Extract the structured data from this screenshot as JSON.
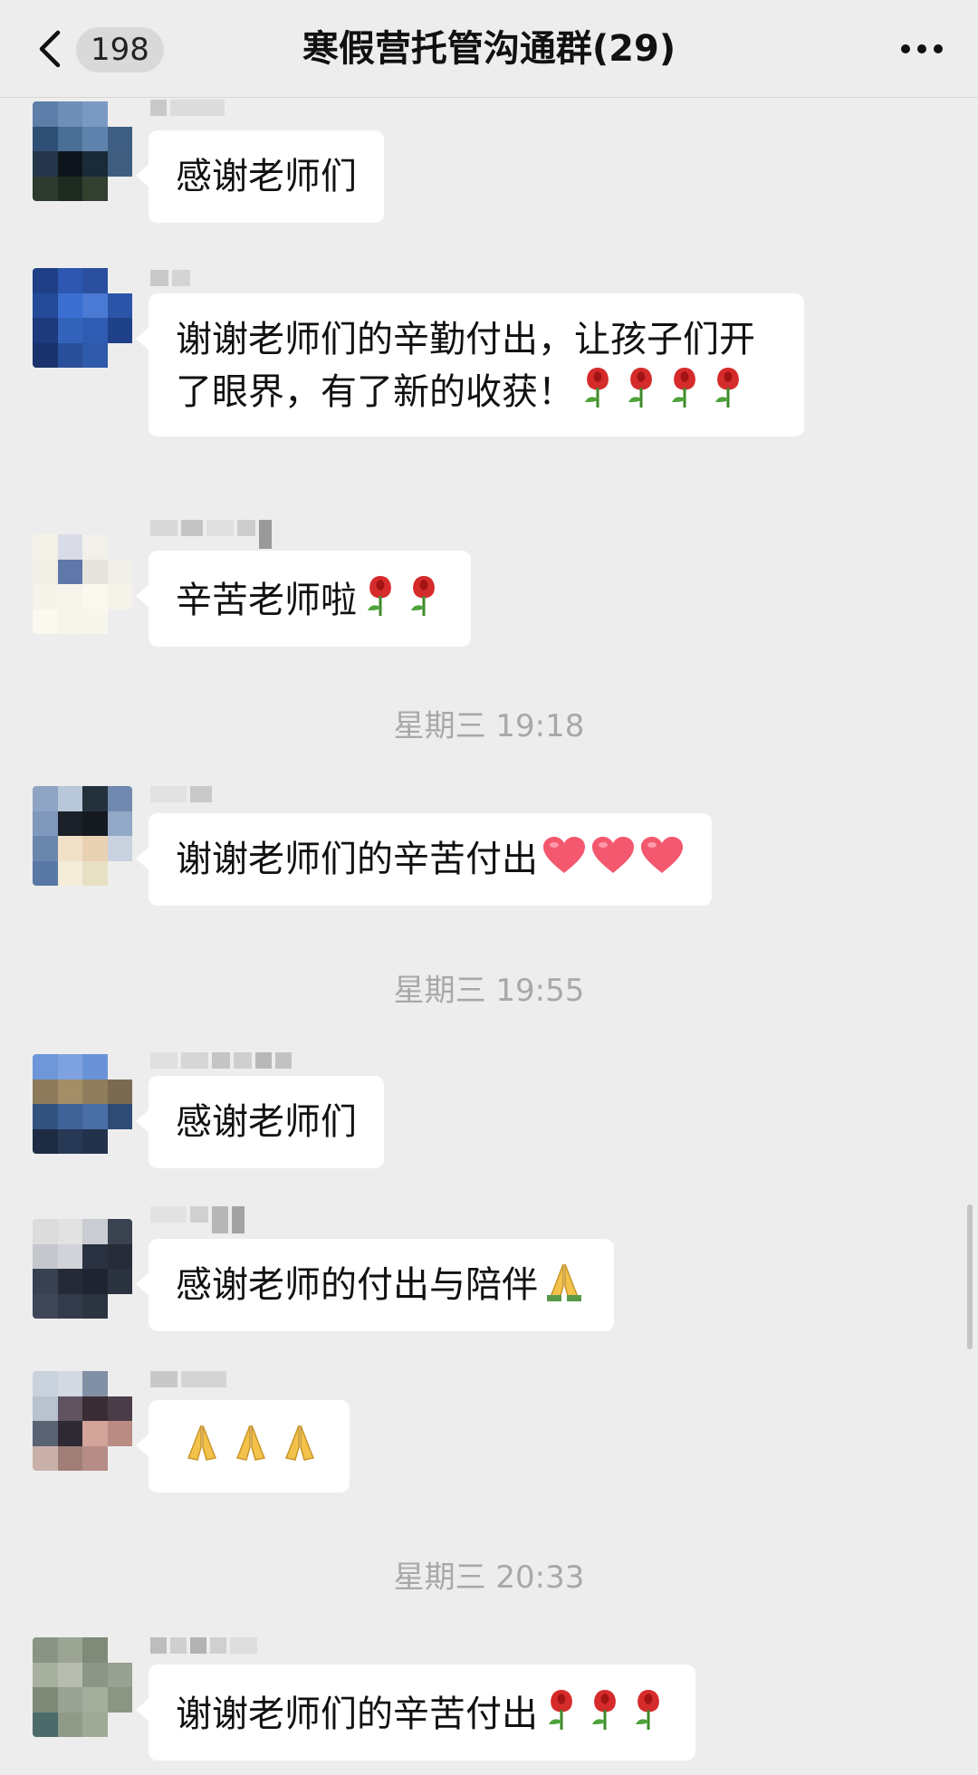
{
  "header": {
    "back_badge": "198",
    "title": "寒假营托管沟通群(29)",
    "icons": {
      "back": "chevron-left-icon",
      "more": "more-dots-icon"
    }
  },
  "messages": [
    {
      "text": "感谢老师们",
      "emoji": null
    },
    {
      "text": "谢谢老师们的辛勤付出，让孩子们开了眼界，有了新的收获！",
      "emoji": "rose-icon",
      "emoji_count": 4
    },
    {
      "text": "辛苦老师啦",
      "emoji": "rose-icon",
      "emoji_count": 2
    },
    {
      "text": "谢谢老师们的辛苦付出",
      "emoji": "heart-icon",
      "emoji_count": 3
    },
    {
      "text": "感谢老师们",
      "emoji": null
    },
    {
      "text": "感谢老师的付出与陪伴",
      "emoji": "folded-hands-icon",
      "emoji_count": 1
    },
    {
      "text": "",
      "emoji": "folded-hands-icon",
      "emoji_count": 3
    },
    {
      "text": "谢谢老师们的辛苦付出",
      "emoji": "rose-icon",
      "emoji_count": 3
    }
  ],
  "timestamps": [
    "星期三 19:18",
    "星期三 19:55",
    "星期三 20:33"
  ],
  "colors": {
    "background": "#ededed",
    "bubble": "#ffffff",
    "timestamp_text": "#a8a8a8"
  }
}
